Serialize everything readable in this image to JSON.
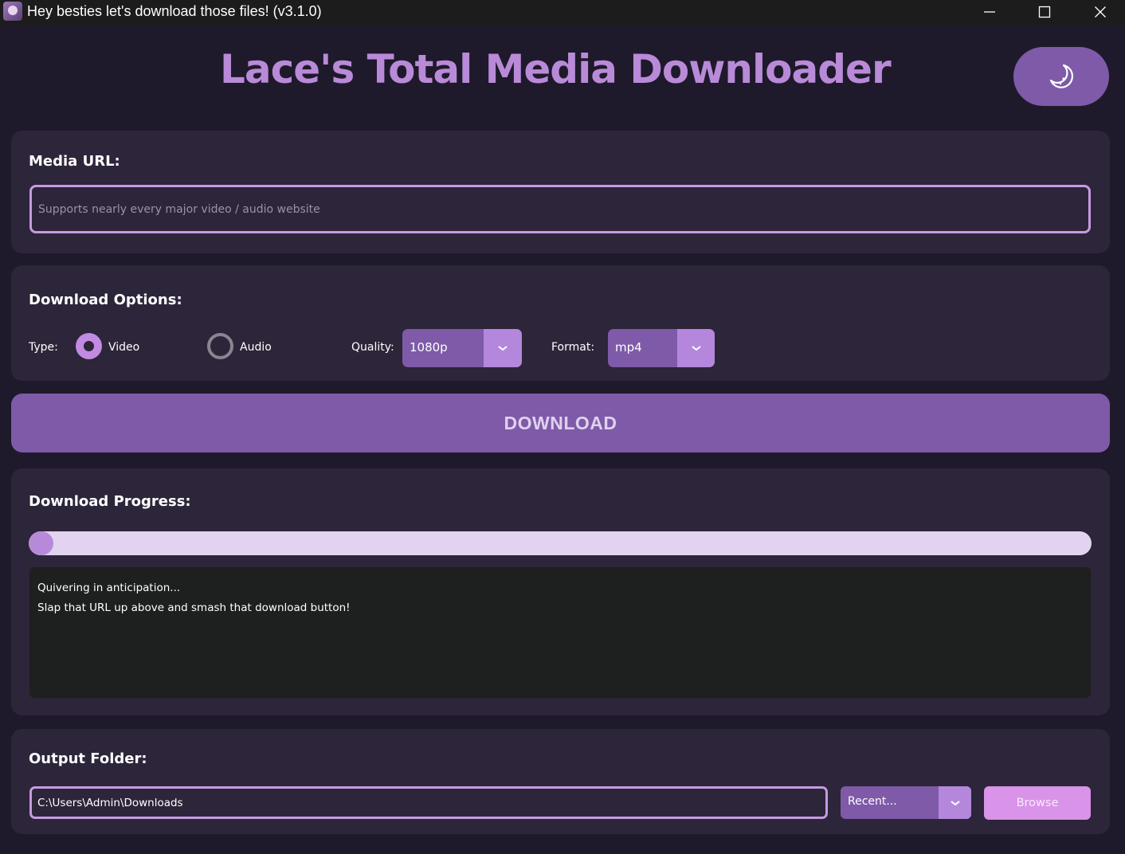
{
  "window": {
    "title": "Hey besties let's download those files! (v3.1.0)",
    "controls": [
      "minimize",
      "maximize",
      "close"
    ]
  },
  "header": {
    "title": "Lace's Total Media Downloader",
    "theme_toggle_icon": "moon-icon"
  },
  "url_section": {
    "label": "Media URL:",
    "value": "",
    "placeholder": "Supports nearly every major video / audio website"
  },
  "options": {
    "label": "Download Options:",
    "type_label": "Type:",
    "type_options": [
      {
        "label": "Video",
        "selected": true
      },
      {
        "label": "Audio",
        "selected": false
      }
    ],
    "quality_label": "Quality:",
    "quality_value": "1080p",
    "format_label": "Format:",
    "format_value": "mp4"
  },
  "download_button": {
    "label": "DOWNLOAD"
  },
  "progress": {
    "label": "Download Progress:",
    "fraction": 0,
    "log": [
      "Quivering in anticipation...",
      "Slap that URL up above and smash that download button!"
    ]
  },
  "output": {
    "label": "Output Folder:",
    "path": "C:\\Users\\Admin\\Downloads",
    "recent_value": "Recent...",
    "browse_label": "Browse"
  },
  "colors": {
    "background": "#1f1a2b",
    "card": "#2d2539",
    "accent": "#7e5aa8",
    "accent_light": "#b487dd",
    "title": "#b98ad8",
    "browse": "#d993e8"
  }
}
